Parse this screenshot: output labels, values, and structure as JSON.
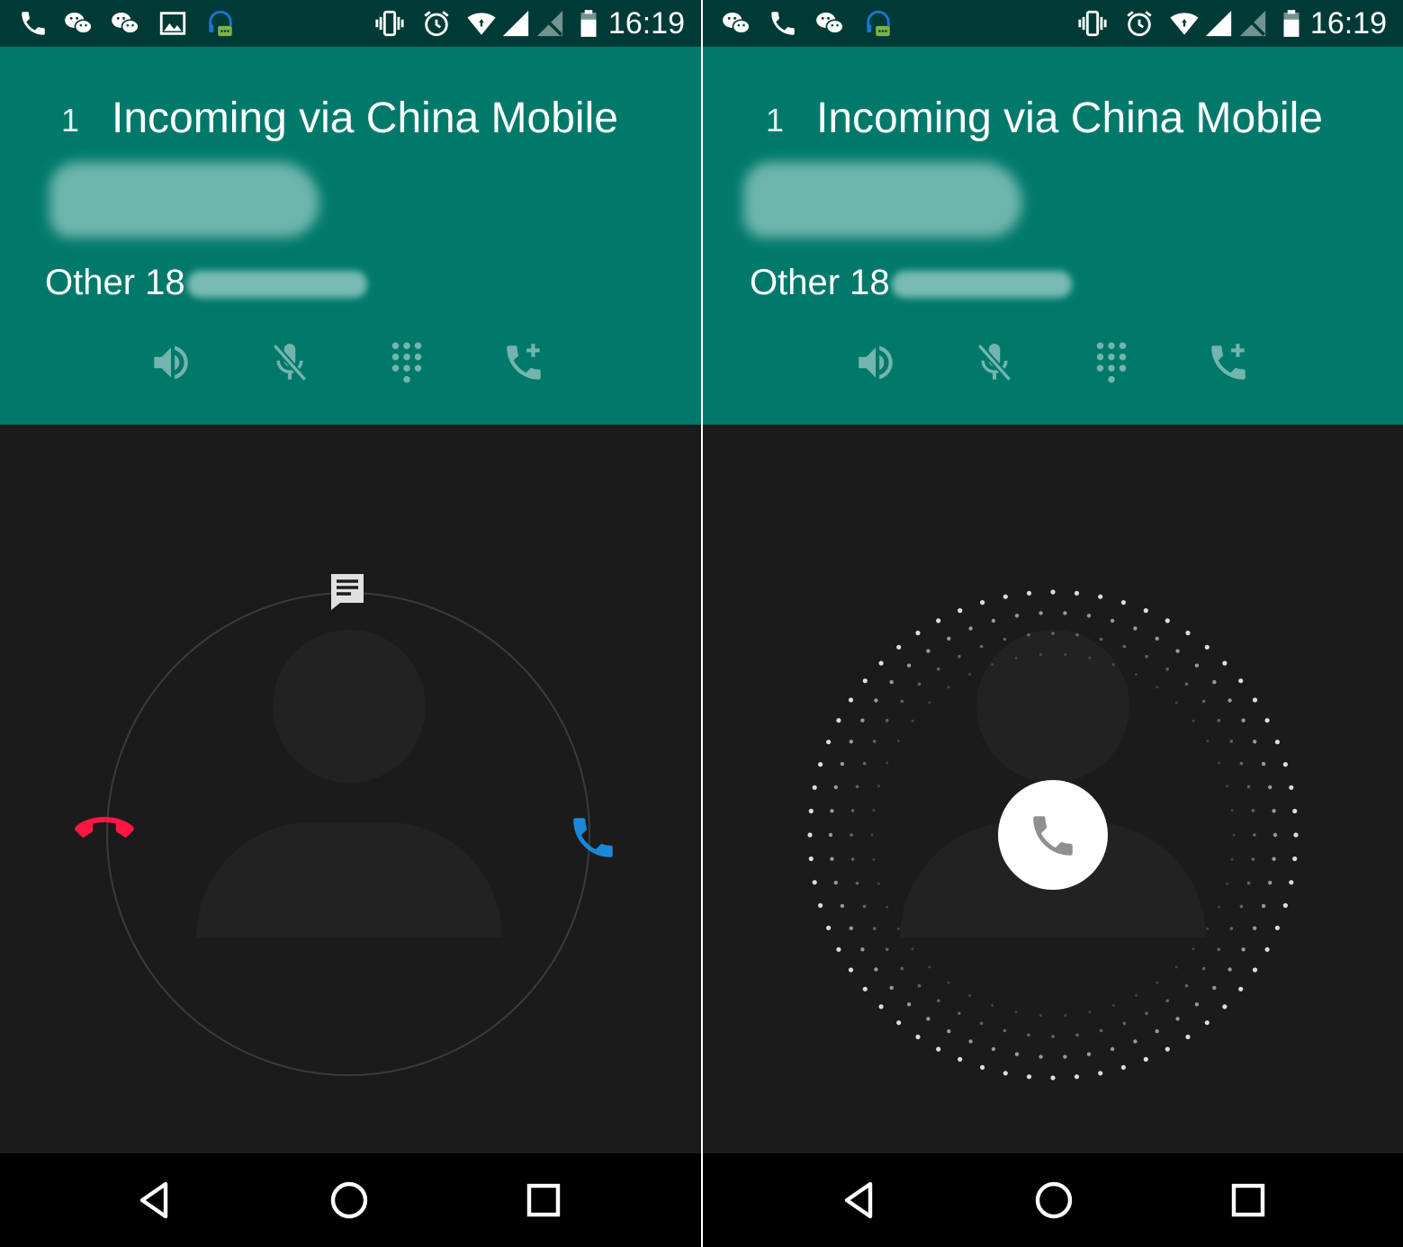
{
  "status_bar": {
    "time": "16:19",
    "left_screen_icons": [
      "phone-icon",
      "wechat-icon",
      "wechat-icon",
      "image-icon",
      "headset-chat-icon"
    ],
    "right_screen_icons": [
      "wechat-icon",
      "phone-icon",
      "wechat-icon",
      "headset-chat-icon"
    ],
    "system_icons": [
      "vibrate-icon",
      "alarm-icon",
      "wifi-icon",
      "cellular-signal-icon",
      "no-sim-icon",
      "battery-icon"
    ]
  },
  "call": {
    "index": "1",
    "title": "Incoming via China Mobile",
    "caller_label_prefix": "Other 18"
  },
  "call_actions": [
    {
      "icon": "speaker-icon"
    },
    {
      "icon": "mute-mic-icon"
    },
    {
      "icon": "dialpad-icon"
    },
    {
      "icon": "add-call-icon"
    }
  ],
  "glowpad_targets": [
    {
      "icon": "message-icon",
      "color": "#e0e0e0"
    },
    {
      "icon": "decline-call-icon",
      "color": "#ff1744"
    },
    {
      "icon": "answer-call-icon",
      "color": "#1a88d8"
    }
  ],
  "answer_button": {
    "icon": "phone-icon",
    "color": "#8f8f8f"
  },
  "nav_bar": [
    {
      "icon": "back-icon"
    },
    {
      "icon": "home-icon"
    },
    {
      "icon": "recents-icon"
    }
  ],
  "colors": {
    "status_bar": "#003a36",
    "call_card": "#00796b",
    "background": "#1b1b1b",
    "nav_bar": "#000000"
  }
}
